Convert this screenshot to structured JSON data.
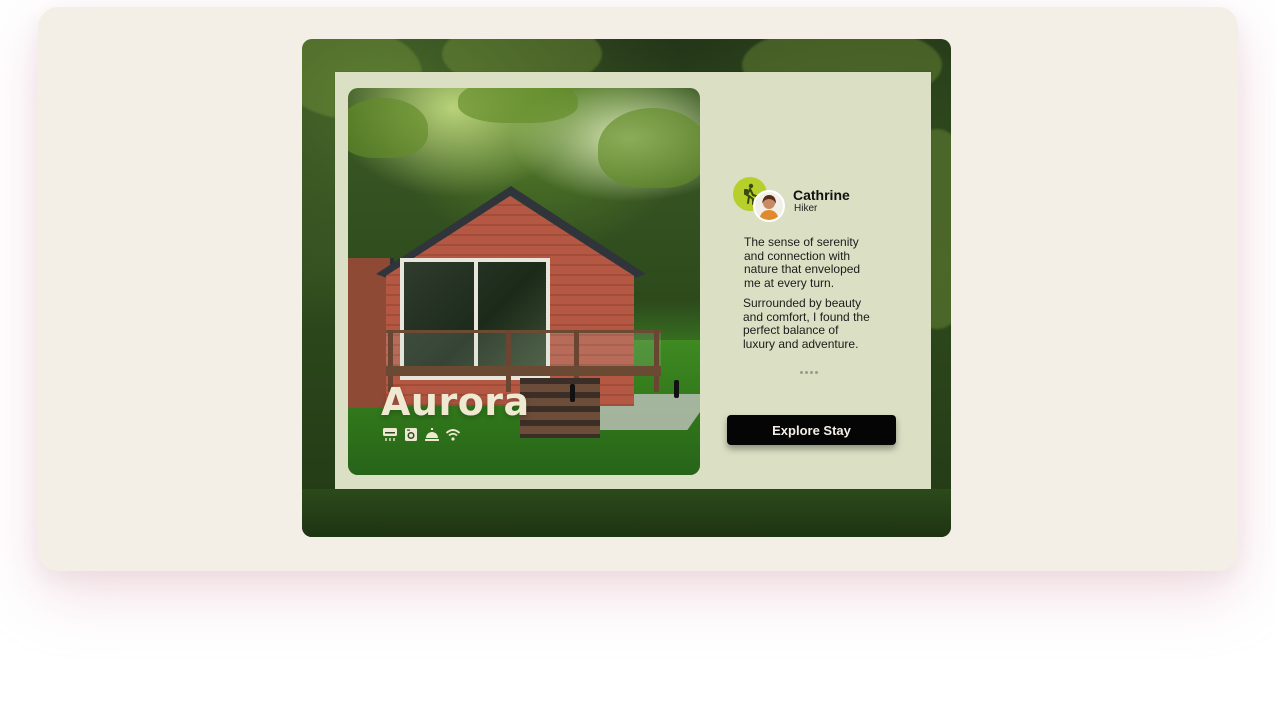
{
  "stay": {
    "name": "Aurora",
    "amenities": [
      {
        "icon": "air-conditioner-icon"
      },
      {
        "icon": "washing-machine-icon"
      },
      {
        "icon": "room-service-bell-icon"
      },
      {
        "icon": "wifi-icon"
      }
    ]
  },
  "testimonial": {
    "author_name": "Cathrine",
    "author_role": "Hiker",
    "badge_icon": "hiker-icon",
    "paragraphs": [
      "The sense of serenity\nand connection with\nnature that enveloped\nme at every turn.",
      "Surrounded by beauty\nand comfort, I found the\nperfect balance of\nluxury and adventure."
    ],
    "carousel_dots": 4
  },
  "cta": {
    "label": "Explore Stay"
  },
  "colors": {
    "page_background": "#f3efe7",
    "panel_background": "#dbdfc3",
    "badge_accent": "#b7cf2a",
    "button_background": "#050505",
    "button_text": "#f3efe7",
    "brand_text": "#efe9d2"
  }
}
